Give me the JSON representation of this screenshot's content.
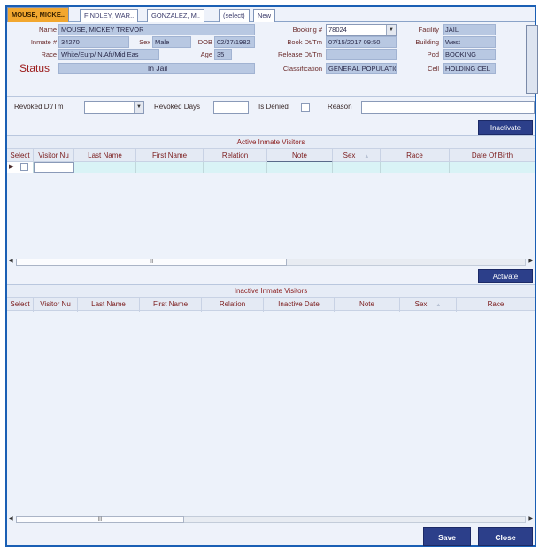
{
  "tabs": [
    {
      "label": "MOUSE, MICKE..",
      "active": true
    },
    {
      "label": "FINDLEY, WAR..",
      "active": false
    },
    {
      "label": "GONZALEZ, M..",
      "active": false
    },
    {
      "label": "(select)",
      "active": false
    },
    {
      "label": "New",
      "active": false
    }
  ],
  "inmate": {
    "name_label": "Name",
    "name": "MOUSE, MICKEY TREVOR",
    "inmate_no_label": "Inmate #",
    "inmate_no": "34270",
    "sex_label": "Sex",
    "sex": "Male",
    "dob_label": "DOB",
    "dob": "02/27/1982",
    "race_label": "Race",
    "race": "White/Eurp/ N.Afr/Mid Eas",
    "age_label": "Age",
    "age": "35",
    "status_label": "Status",
    "status": "In Jail"
  },
  "booking": {
    "booking_no_label": "Booking #",
    "booking_no": "78024",
    "book_dttm_label": "Book Dt/Tm",
    "book_dttm": "07/15/2017 09:50",
    "release_dttm_label": "Release Dt/Tm",
    "release_dttm": "",
    "classification_label": "Classification",
    "classification": "GENERAL POPULATIOI"
  },
  "location": {
    "facility_label": "Facility",
    "facility": "JAIL",
    "building_label": "Building",
    "building": "West",
    "pod_label": "Pod",
    "pod": "BOOKING",
    "cell_label": "Cell",
    "cell": "HOLDING CEL"
  },
  "revoked": {
    "revoked_dttm_label": "Revoked Dt/Tm",
    "revoked_days_label": "Revoked Days",
    "is_denied_label": "Is Denied",
    "reason_label": "Reason"
  },
  "active_grid": {
    "inactivate_label": "Inactivate",
    "title": "Active Inmate Visitors",
    "columns": [
      "Select",
      "Visitor Nu",
      "Last Name",
      "First Name",
      "Relation",
      "Note",
      "Sex",
      "Race",
      "Date Of Birth"
    ],
    "scroll_thumb": "III"
  },
  "inactive_grid": {
    "activate_label": "Activate",
    "title": "Inactive Inmate Visitors",
    "columns": [
      "Select",
      "Visitor Nu",
      "Last Name",
      "First Name",
      "Relation",
      "Inactive Date",
      "Note",
      "Sex",
      "Race"
    ],
    "scroll_thumb": "III"
  },
  "footer": {
    "save_label": "Save",
    "close_label": "Close"
  },
  "colors": {
    "active_tab": "#f2a72f",
    "button": "#2c3f8a",
    "frame": "#1a5fb4",
    "label_text": "#6a2a2a"
  }
}
